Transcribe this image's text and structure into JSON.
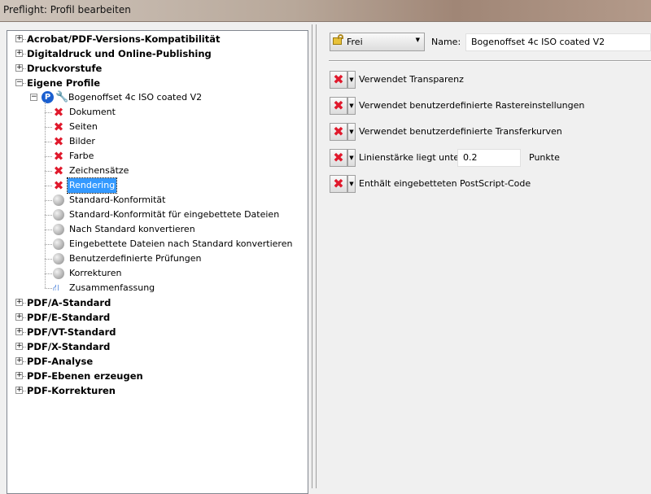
{
  "window": {
    "title": "Preflight: Profil bearbeiten"
  },
  "tree": {
    "top_before": [
      {
        "label": "Acrobat/PDF-Versions-Kompatibilität",
        "expanded": false
      },
      {
        "label": "Digitaldruck und Online-Publishing",
        "expanded": false
      },
      {
        "label": "Druckvorstufe",
        "expanded": false
      },
      {
        "label": "Eigene Profile",
        "expanded": true
      }
    ],
    "profile": {
      "label": "Bogenoffset 4c ISO coated V2"
    },
    "children": [
      {
        "label": "Dokument",
        "icon": "x"
      },
      {
        "label": "Seiten",
        "icon": "x"
      },
      {
        "label": "Bilder",
        "icon": "x"
      },
      {
        "label": "Farbe",
        "icon": "x"
      },
      {
        "label": "Zeichensätze",
        "icon": "x"
      },
      {
        "label": "Rendering",
        "icon": "x",
        "selected": true
      },
      {
        "label": "Standard-Konformität",
        "icon": "ball"
      },
      {
        "label": "Standard-Konformität für eingebettete Dateien",
        "icon": "ball"
      },
      {
        "label": "Nach Standard konvertieren",
        "icon": "ball"
      },
      {
        "label": "Eingebettete Dateien nach Standard konvertieren",
        "icon": "ball"
      },
      {
        "label": "Benutzerdefinierte Prüfungen",
        "icon": "ball"
      },
      {
        "label": "Korrekturen",
        "icon": "ball"
      },
      {
        "label": "Zusammenfassung",
        "icon": "summary"
      }
    ],
    "top_after": [
      {
        "label": "PDF/A-Standard"
      },
      {
        "label": "PDF/E-Standard"
      },
      {
        "label": "PDF/VT-Standard"
      },
      {
        "label": "PDF/X-Standard"
      },
      {
        "label": "PDF-Analyse"
      },
      {
        "label": "PDF-Ebenen erzeugen"
      },
      {
        "label": "PDF-Korrekturen"
      }
    ]
  },
  "panel": {
    "lock_select": "Frei",
    "name_label": "Name:",
    "name_value": "Bogenoffset 4c ISO coated V2",
    "checks": [
      {
        "label": "Verwendet Transparenz"
      },
      {
        "label": "Verwendet benutzerdefinierte Rastereinstellungen"
      },
      {
        "label": "Verwendet benutzerdefinierte Transferkurven"
      },
      {
        "label": "Linienstärke liegt unter",
        "value": "0.2",
        "unit": "Punkte"
      },
      {
        "label": "Enthält eingebetteten PostScript-Code"
      }
    ]
  }
}
